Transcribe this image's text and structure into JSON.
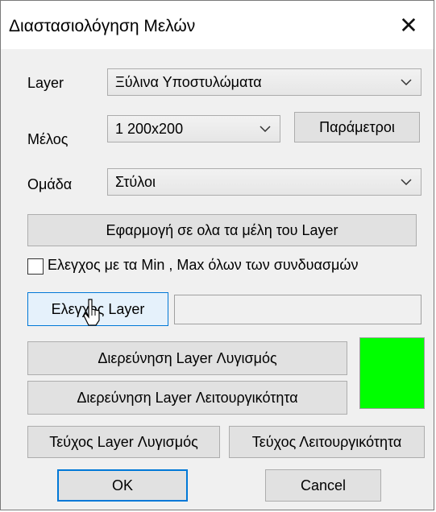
{
  "window": {
    "title": "Διαστασιολόγηση Μελών",
    "close_icon": "close-icon"
  },
  "layer": {
    "label": "Layer",
    "value": "Ξύλινα Υποστυλώματα"
  },
  "member": {
    "label": "Μέλος",
    "value": "1 200x200"
  },
  "params_button": "Παράμετροι",
  "group": {
    "label": "Ομάδα",
    "value": "Στύλοι"
  },
  "apply_all_button": "Εφαρμογή σε ολα τα μέλη του Layer",
  "check_minmax": {
    "label": "Ελεγχος με τα Min , Max όλων των συνδυασμών",
    "checked": false
  },
  "check_layer_button": "Ελεγχος Layer",
  "check_layer_result": "",
  "investigate_failure_button": "Διερεύνηση Layer Λυγισμός",
  "investigate_service_button": "Διερεύνηση Layer Λειτουργικότητα",
  "status_color": "#00ff00",
  "report_failure_button": "Τεύχος Layer Λυγισμός",
  "report_service_button": "Τεύχος Λειτουργικότητα",
  "ok_button": "OK",
  "cancel_button": "Cancel"
}
